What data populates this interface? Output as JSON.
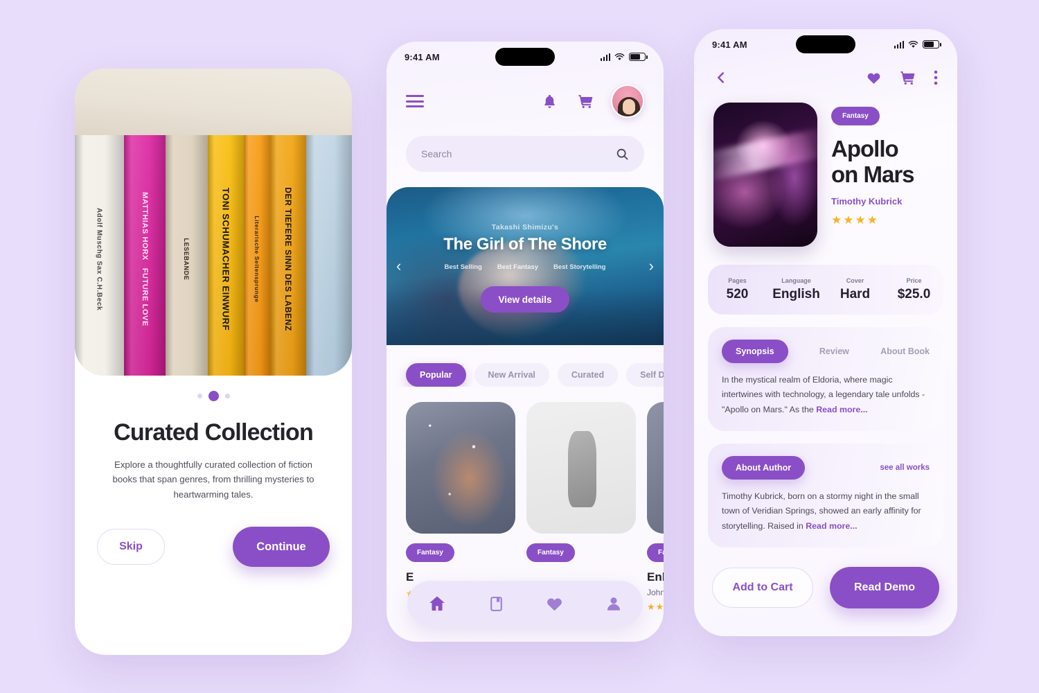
{
  "theme": {
    "accent": "#8a4fc6",
    "background": "#e8ddfb",
    "star": "#f5b429",
    "text_dark": "#24212b",
    "text_muted": "#6d6880"
  },
  "status_bar": {
    "time": "9:41 AM",
    "signal_icon": "signal-bars-icon",
    "wifi_icon": "wifi-icon",
    "battery_icon": "battery-icon"
  },
  "onboarding": {
    "hero_alt": "bookshelf-photo",
    "books": [
      {
        "title": "",
        "color": "#f2efe8",
        "text_color": "#3a3a3a"
      },
      {
        "title": "MATTHIAS HORX  FUTURE LOVE",
        "color": "#d8219b",
        "text_color": "#ffffff"
      },
      {
        "title": "LESEBANDE",
        "color": "#ded2bd",
        "text_color": "#2b2b2b"
      },
      {
        "title": "TONI SCHUMACHER EINWURF",
        "color": "#f5b60d",
        "text_color": "#1a1a1a"
      },
      {
        "title": "Literarische Seitensprunge",
        "color": "#f59a13",
        "text_color": "#2b2b2b"
      },
      {
        "title": "DER TIEFERE SINN DES LABENZ",
        "color": "#f0a316",
        "text_color": "#1a1a1a"
      },
      {
        "title": "",
        "color": "#b9cfe0",
        "text_color": "#1a1a1a"
      }
    ],
    "dots": [
      {
        "active": false
      },
      {
        "active": true
      },
      {
        "active": false
      }
    ],
    "title": "Curated Collection",
    "subtitle": "Explore a thoughtfully curated collection of fiction books that span genres, from thrilling mysteries to heartwarming tales.",
    "skip_label": "Skip",
    "continue_label": "Continue"
  },
  "home": {
    "menu_icon": "hamburger-menu-icon",
    "bell_icon": "notification-bell-icon",
    "cart_icon": "shopping-cart-icon",
    "avatar_label": "user-avatar",
    "search": {
      "placeholder": "Search",
      "icon": "search-icon"
    },
    "banner": {
      "kicker": "Takashi Shimizu's",
      "title": "The Girl of The Shore",
      "tags": [
        "Best Selling",
        "Best Fantasy",
        "Best Storytelling"
      ],
      "cta": "View details",
      "prev_icon": "chevron-left-icon",
      "next_icon": "chevron-right-icon"
    },
    "chips": [
      {
        "label": "Popular",
        "active": true
      },
      {
        "label": "New Arrival",
        "active": false
      },
      {
        "label": "Curated",
        "active": false
      },
      {
        "label": "Self Development",
        "active": false
      }
    ],
    "cards": [
      {
        "tag": "Fantasy",
        "title": "E",
        "author": "",
        "stars": "★",
        "image": "warrior-woman-snow-photo"
      },
      {
        "tag": "Fantasy",
        "title": "",
        "author": "",
        "stars": "",
        "image": "statue-spear-photo"
      },
      {
        "tag": "Fantasy",
        "title": "Enh",
        "author": "John",
        "stars": "★★",
        "image": "warrior-woman-photo"
      }
    ],
    "tabs": [
      {
        "name": "home",
        "icon": "home-icon",
        "active": true
      },
      {
        "name": "library",
        "icon": "book-icon",
        "active": false
      },
      {
        "name": "favorites",
        "icon": "heart-icon",
        "active": false
      },
      {
        "name": "profile",
        "icon": "person-icon",
        "active": false
      }
    ]
  },
  "detail": {
    "back_icon": "chevron-left-icon",
    "heart_icon": "heart-icon",
    "cart_icon": "shopping-cart-icon",
    "more_icon": "more-vertical-icon",
    "cover_alt": "apollo-on-mars-book-cover",
    "genre": "Fantasy",
    "title": "Apollo\non Mars",
    "title_line1": "Apollo",
    "title_line2": "on Mars",
    "author": "Timothy Kubrick",
    "rating_stars": "★★★★",
    "stats": [
      {
        "key": "Pages",
        "value": "520"
      },
      {
        "key": "Language",
        "value": "English"
      },
      {
        "key": "Cover",
        "value": "Hard"
      },
      {
        "key": "Price",
        "value": "$25.0"
      }
    ],
    "synopsis": {
      "tabs": [
        {
          "label": "Synopsis",
          "active": true
        },
        {
          "label": "Review",
          "active": false
        },
        {
          "label": "About Book",
          "active": false
        }
      ],
      "body": "In the mystical realm of Eldoria, where magic intertwines with technology, a legendary tale unfolds - \"Apollo on Mars.\" As the ",
      "read_more": "Read more..."
    },
    "about_author": {
      "pill": "About Author",
      "see_all": "see all works",
      "body": "Timothy Kubrick, born on a stormy night in the small town of Veridian Springs, showed an early affinity for storytelling. Raised in ",
      "read_more": "Read more..."
    },
    "add_to_cart_label": "Add to Cart",
    "read_demo_label": "Read Demo"
  }
}
